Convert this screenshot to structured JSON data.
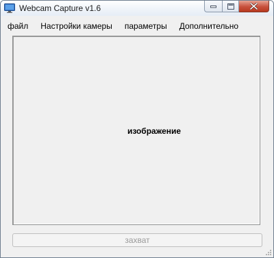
{
  "window": {
    "title": "Webcam Capture v1.6"
  },
  "menu": {
    "items": [
      {
        "label": "файл"
      },
      {
        "label": "Настройки камеры"
      },
      {
        "label": "параметры"
      },
      {
        "label": "Дополнительно"
      }
    ]
  },
  "preview": {
    "label": "изображение"
  },
  "capture_button": {
    "label": "захват",
    "enabled": false
  },
  "colors": {
    "window_bg": "#f0f0f0",
    "close_button": "#c7503c",
    "disabled_text": "#9a9a9a"
  },
  "icons": {
    "app": "monitor-icon",
    "minimize": "minimize-icon",
    "maximize": "maximize-icon",
    "close": "close-icon"
  }
}
